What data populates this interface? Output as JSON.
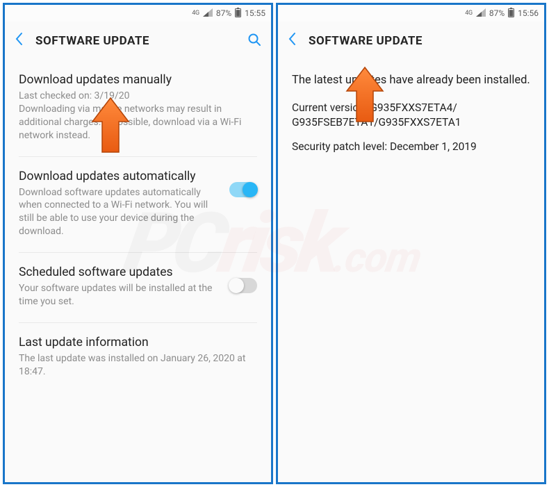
{
  "status": {
    "network": "4G",
    "battery_pct": "87%",
    "time_left": "15:55",
    "time_right": "15:56"
  },
  "header": {
    "title": "SOFTWARE UPDATE"
  },
  "left": {
    "manual": {
      "title": "Download updates manually",
      "last_checked": "Last checked on: 3/19/20",
      "desc": "Downloading via mobile networks may result in additional charges. If possible, download via a Wi-Fi network instead."
    },
    "auto": {
      "title": "Download updates automatically",
      "desc": "Download software updates automatically when connected to a Wi-Fi network. You will still be able to use your device during the download.",
      "enabled": true
    },
    "scheduled": {
      "title": "Scheduled software updates",
      "desc": "Your software updates will be installed at the time you set.",
      "enabled": false
    },
    "last": {
      "title": "Last update information",
      "desc": "The last update was installed on January 26, 2020 at 18:47."
    }
  },
  "right": {
    "msg": "The latest updates have already been installed.",
    "version_label": "Current version: G935FXXS7ETA4/\nG935FSEB7ETA1/G935FXXS7ETA1",
    "patch": "Security patch level: December 1, 2019"
  },
  "watermark": {
    "a": "PC",
    "b": "risk",
    "c": ".com"
  }
}
